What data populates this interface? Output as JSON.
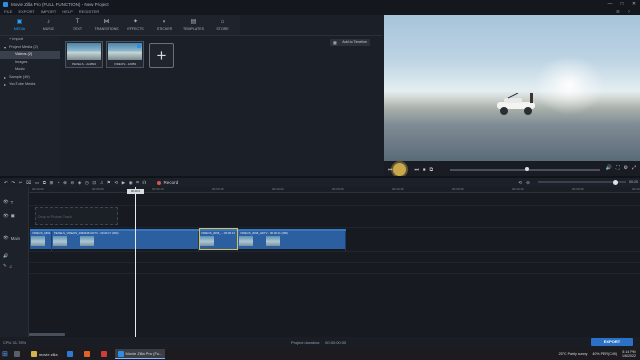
{
  "window": {
    "title": "Movie Zilla Pro (FULL FUNCTION) - New Project",
    "controls": [
      "—",
      "□",
      "✕"
    ]
  },
  "menu": {
    "items": [
      "FILE",
      "EXPORT",
      "IMPORT",
      "HELP",
      "REGISTER"
    ],
    "account_icons": [
      "☰",
      "?",
      "—",
      "□",
      "✕"
    ]
  },
  "toolbar": {
    "tabs": [
      {
        "label": "MEDIA",
        "icon": "media-icon",
        "glyph": "▣",
        "active": true
      },
      {
        "label": "MUSIC",
        "icon": "music-icon",
        "glyph": "♪",
        "active": false
      },
      {
        "label": "TEXT",
        "icon": "text-icon",
        "glyph": "T",
        "active": false
      },
      {
        "label": "TRANSITIONS",
        "icon": "transitions-icon",
        "glyph": "⋈",
        "active": false
      },
      {
        "label": "EFFECTS",
        "icon": "effects-icon",
        "glyph": "✦",
        "active": false
      },
      {
        "label": "STICKER",
        "icon": "sticker-icon",
        "glyph": "◐",
        "active": false
      },
      {
        "label": "TEMPLATES",
        "icon": "templates-icon",
        "glyph": "▤",
        "active": false
      },
      {
        "label": "STORE",
        "icon": "store-icon",
        "glyph": "⌂",
        "active": false
      }
    ]
  },
  "sidebar": {
    "items": [
      {
        "label": "+ Import",
        "caret": "",
        "selected": false,
        "indent": 0
      },
      {
        "label": "Project Media (2)",
        "caret": "▾",
        "selected": false,
        "indent": 0
      },
      {
        "label": "Videos (2)",
        "caret": "",
        "selected": true,
        "indent": 1
      },
      {
        "label": "Images",
        "caret": "",
        "selected": false,
        "indent": 1
      },
      {
        "label": "Music",
        "caret": "",
        "selected": false,
        "indent": 1
      },
      {
        "label": "Sample (49)",
        "caret": "▸",
        "selected": false,
        "indent": 0
      },
      {
        "label": "YouTube Media",
        "caret": "▸",
        "selected": false,
        "indent": 0
      }
    ]
  },
  "media": {
    "add_to_timeline": "Add to Timeline",
    "thumbs": [
      {
        "caption": "PEXELS...dcd894"
      },
      {
        "caption": "VIDEOS...12883"
      }
    ],
    "add_glyph": "+"
  },
  "preview": {
    "progress": 0.5
  },
  "playback": {
    "glyphs": [
      "⏮",
      "⏯",
      "⏭",
      "⏹",
      "⧉"
    ],
    "right_glyphs": [
      "🔊",
      "⛶",
      "⚙",
      "⤢"
    ]
  },
  "timeline_toolbar": {
    "tools": [
      "↶",
      "↷",
      "✂",
      "⌧",
      "▭",
      "⧉",
      "⊞",
      "◔",
      "⊕",
      "⊖",
      "◈",
      "◷",
      "⊡",
      "♫",
      "⚑",
      "⟲",
      "▶",
      "◉",
      "⌗",
      "☊"
    ],
    "record_label": "Record",
    "zoom_label": "00:20"
  },
  "ruler": {
    "ticks": [
      "00:00:00",
      "00:00:05",
      "00:00:10",
      "00:00:15",
      "00:00:20",
      "00:00:25",
      "00:00:30",
      "00:00:35",
      "00:00:40",
      "00:00:45",
      "00:00:50"
    ]
  },
  "tracks": {
    "pip_label": "Drop to Picture Track",
    "main_label": "Main",
    "clips": [
      {
        "label": "VIDEOS_1863",
        "width": 22
      },
      {
        "label": "PEXELS_VIDEOS_2096948 HDTV - 00:00:17 (360)",
        "width": 147
      },
      {
        "label": "VIDEOS_2096_...:00:00:13",
        "width": 39
      },
      {
        "label": "VIDEOS_2096_HDTV - 00:00:11 (360)",
        "width": 108
      }
    ],
    "playhead_label": "00:00:0"
  },
  "status": {
    "cpu": "CPU 31.78%",
    "duration_label": "Project duration:",
    "duration": "00:00:00:00"
  },
  "export_label": "EXPORT",
  "taskbar": {
    "apps": [
      {
        "label": "",
        "color": "#5a5f69",
        "active": false
      },
      {
        "label": "movie zilla",
        "color": "#d7b24a",
        "active": false
      },
      {
        "label": "",
        "color": "#2d7ad6",
        "active": false
      },
      {
        "label": "",
        "color": "#e0622a",
        "active": false
      },
      {
        "label": "",
        "color": "#d33b3b",
        "active": false
      },
      {
        "label": "Movie Zilla Pro (Fu...",
        "color": "#2a8fe6",
        "active": true
      }
    ],
    "weather": "25°C Partly sunny",
    "battery": "40% PER(C49)",
    "time": "5:14 PM",
    "date": "1/6/2022"
  }
}
